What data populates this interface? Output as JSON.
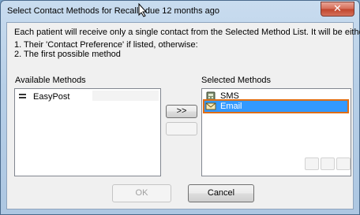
{
  "window": {
    "title": "Select Contact Methods for Recalls due 12 months ago",
    "close_label": "✕"
  },
  "info": {
    "line1": "Each patient will receive only a single contact from the Selected Method List. It will be either;",
    "line2": "1. Their 'Contact Preference' if listed, otherwise:",
    "line3": "2. The first possible method"
  },
  "available": {
    "label": "Available Methods",
    "items": [
      {
        "label": "EasyPost"
      }
    ]
  },
  "transfer": {
    "add_label": ">>",
    "remove_label": ""
  },
  "selected": {
    "label": "Selected Methods",
    "items": [
      {
        "label": "SMS",
        "icon": "phone-icon"
      },
      {
        "label": "Email",
        "icon": "email-icon",
        "selected": true
      }
    ]
  },
  "footer": {
    "ok_label": "OK",
    "cancel_label": "Cancel"
  }
}
